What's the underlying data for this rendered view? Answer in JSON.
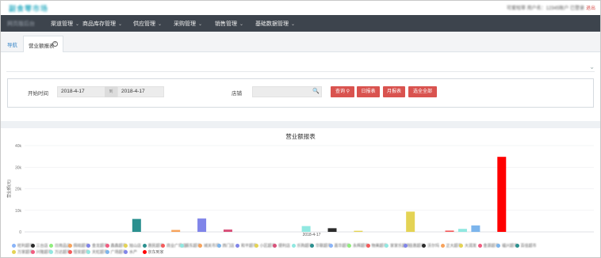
{
  "header": {
    "logo_text": "副食零市场",
    "user_text": "可爱短草 用户名：12345账户 已登录",
    "logout": "退出"
  },
  "navbar": {
    "brand": "网页版后台",
    "items": [
      {
        "label": "渠道管理"
      },
      {
        "label": "商品库存管理"
      },
      {
        "label": "供应管理"
      },
      {
        "label": "采购管理"
      },
      {
        "label": "销售管理"
      },
      {
        "label": "基础数据管理"
      }
    ]
  },
  "tabs": {
    "nav_label": "导航",
    "active_label": "营业额报表",
    "close_symbol": "×"
  },
  "filter": {
    "start_label": "开始时间",
    "start_date": "2018-4-17",
    "range_sep": "到",
    "end_date": "2018-4-17",
    "store_label": "店铺",
    "store_value": "",
    "buttons": {
      "query": "查询",
      "daily": "日报表",
      "monthly": "月报表",
      "select_all": "选全全部"
    }
  },
  "chart_data": {
    "type": "bar",
    "title": "营业额报表",
    "ylabel": "营业额(元)",
    "ylim": [
      0,
      40000
    ],
    "yticks": [
      0,
      10000,
      20000,
      30000,
      40000
    ],
    "ytick_labels": [
      "0",
      "10k",
      "20k",
      "30k",
      "40k"
    ],
    "categories": [
      "2018-4-17"
    ],
    "series": [
      {
        "name": "旺利超市",
        "color": "#8ab4f8",
        "values": [
          0
        ]
      },
      {
        "name": "三台店",
        "color": "#2b2b2b",
        "values": [
          0
        ]
      },
      {
        "name": "日用品店",
        "color": "#90ed7d",
        "values": [
          0
        ]
      },
      {
        "name": "佩晓超市",
        "color": "#f7a35c",
        "values": [
          0
        ]
      },
      {
        "name": "金龙超市",
        "color": "#8085e9",
        "values": [
          0
        ]
      },
      {
        "name": "鑫鑫超市",
        "color": "#f15c80",
        "values": [
          0
        ]
      },
      {
        "name": "旭山店",
        "color": "#e4d354",
        "values": [
          0
        ]
      },
      {
        "name": "惠民超市",
        "color": "#2b908f",
        "values": [
          6000
        ]
      },
      {
        "name": "商业广场店",
        "color": "#f45b5b",
        "values": [
          0
        ]
      },
      {
        "name": "振东超市",
        "color": "#91e8e1",
        "values": [
          0
        ]
      },
      {
        "name": "城关市场",
        "color": "#f7a35c",
        "values": [
          900
        ]
      },
      {
        "name": "西门店",
        "color": "#7cb5ec",
        "values": [
          0
        ]
      },
      {
        "name": "和平超市",
        "color": "#8085e9",
        "values": [
          6200
        ]
      },
      {
        "name": "小区超市",
        "color": "#e4d354",
        "values": [
          0
        ]
      },
      {
        "name": "便利店",
        "color": "#d9527a",
        "values": [
          1100
        ]
      },
      {
        "name": "乐购超市",
        "color": "#91e8e1",
        "values": [
          0
        ]
      },
      {
        "name": "华联超市",
        "color": "#2b908f",
        "values": [
          0
        ]
      },
      {
        "name": "嘉华超市",
        "color": "#8ab4f8",
        "values": [
          0
        ]
      },
      {
        "name": "永辉超市",
        "color": "#90ed7d",
        "values": [
          0
        ]
      },
      {
        "name": "物美超市",
        "color": "#f45b5b",
        "values": [
          0
        ]
      },
      {
        "name": "家家乐超市",
        "color": "#91e8e1",
        "values": [
          2700
        ]
      },
      {
        "name": "佳惠超市",
        "color": "#8085e9",
        "values": [
          0
        ]
      },
      {
        "name": "沃尔玛",
        "color": "#2b2b2b",
        "values": [
          1700
        ]
      },
      {
        "name": "正大超市",
        "color": "#f7a35c",
        "values": [
          0
        ]
      },
      {
        "name": "大润发",
        "color": "#e4d354",
        "values": [
          500
        ]
      },
      {
        "name": "金源超市",
        "color": "#f15c80",
        "values": [
          0
        ]
      },
      {
        "name": "福兴超市",
        "color": "#7cb5ec",
        "values": [
          0
        ]
      },
      {
        "name": "百佳超市",
        "color": "#2b908f",
        "values": [
          0
        ]
      },
      {
        "name": "万家超市",
        "color": "#e4d354",
        "values": [
          9400
        ]
      },
      {
        "name": "兴隆超市",
        "color": "#f15c80",
        "values": [
          0
        ]
      },
      {
        "name": "万达超市",
        "color": "#91e8e1",
        "values": [
          0
        ]
      },
      {
        "name": "恒安超市",
        "color": "#f45b5b",
        "values": [
          600
        ]
      },
      {
        "name": "天虹超市",
        "color": "#91e8e1",
        "values": [
          1400
        ]
      },
      {
        "name": "广场超市",
        "color": "#7cb5ec",
        "values": [
          3000
        ]
      },
      {
        "name": "水产",
        "color": "#8085e9",
        "values": [
          0
        ]
      },
      {
        "name": "京东到家",
        "color": "#ff0000",
        "values": [
          34800
        ]
      }
    ]
  }
}
